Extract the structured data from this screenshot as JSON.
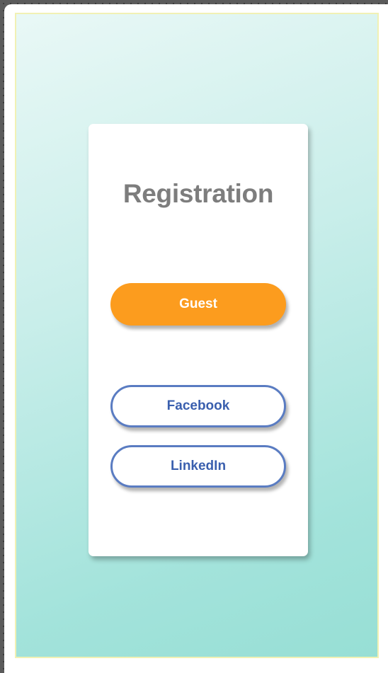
{
  "registration": {
    "title": "Registration",
    "guest_label": "Guest",
    "facebook_label": "Facebook",
    "linkedin_label": "LinkedIn"
  },
  "colors": {
    "accent_orange": "#fc9c1e",
    "outline_blue": "#5a7cc2",
    "outline_text_blue": "#3a5fae",
    "title_gray": "#7d7d7d",
    "background_teal": "#97dfd5"
  }
}
